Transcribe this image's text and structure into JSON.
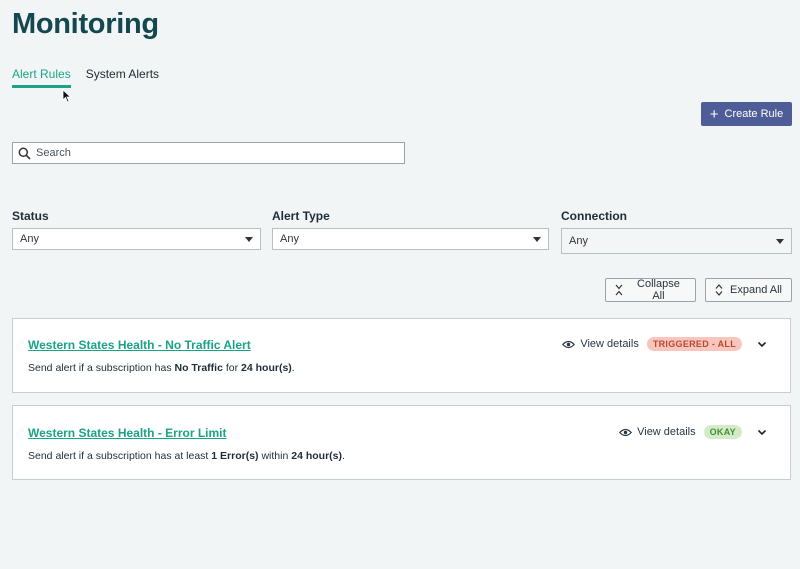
{
  "page": {
    "title": "Monitoring"
  },
  "tabs": [
    {
      "label": "Alert Rules",
      "active": true
    },
    {
      "label": "System Alerts",
      "active": false
    }
  ],
  "toolbar": {
    "create_label": "Create Rule"
  },
  "search": {
    "placeholder": "Search",
    "value": ""
  },
  "filters": {
    "status": {
      "label": "Status",
      "value": "Any"
    },
    "alert_type": {
      "label": "Alert Type",
      "value": "Any"
    },
    "connection": {
      "label": "Connection",
      "value": "Any"
    }
  },
  "actions": {
    "collapse_all": "Collapse All",
    "expand_all": "Expand All"
  },
  "rules": [
    {
      "title": "Western States Health - No Traffic Alert",
      "view_details": "View details",
      "status": "TRIGGERED - ALL",
      "desc_prefix": "Send alert if a subscription has ",
      "desc_bold1": "No Traffic",
      "desc_mid": " for ",
      "desc_bold2": "24 hour(s)",
      "desc_suffix": "."
    },
    {
      "title": "Western States Health - Error Limit",
      "view_details": "View details",
      "status": "OKAY",
      "desc_prefix": "Send alert if a subscription has at least ",
      "desc_bold1": "1 Error(s)",
      "desc_mid": " within ",
      "desc_bold2": "24 hour(s)",
      "desc_suffix": "."
    }
  ],
  "colors": {
    "accent": "#1aa487",
    "primary_button": "#4e5c98",
    "title": "#14474f"
  }
}
